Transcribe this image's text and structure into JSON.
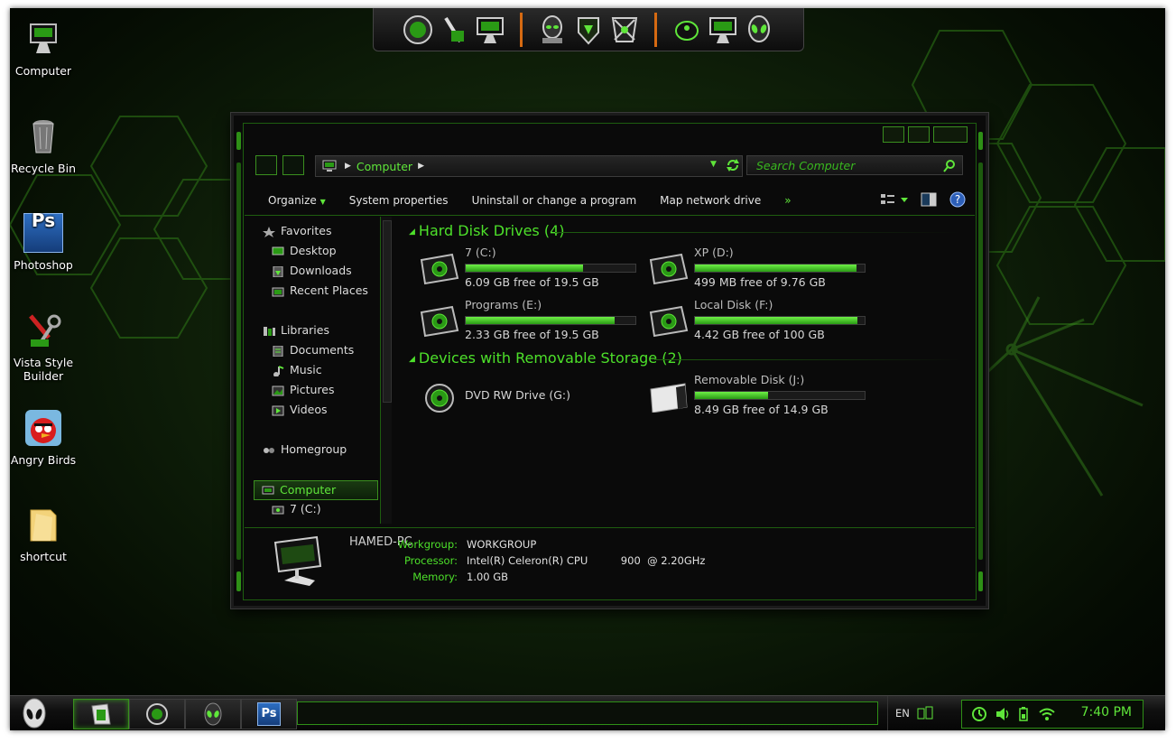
{
  "desktop": {
    "icons": [
      {
        "label": "Computer",
        "icon": "computer-icon"
      },
      {
        "label": "Recycle Bin",
        "icon": "recycle-bin-icon"
      },
      {
        "label": "Photoshop",
        "icon": "photoshop-icon",
        "badge": "Ps"
      },
      {
        "label": "Vista Style Builder",
        "icon": "vista-style-builder-icon"
      },
      {
        "label": "Angry Birds",
        "icon": "angry-birds-icon"
      },
      {
        "label": "shortcut",
        "icon": "folder-icon"
      }
    ]
  },
  "dock": {
    "groups": [
      [
        "alien-head-icon",
        "stylus-icon",
        "monitor-icon"
      ],
      [
        "alien-bust-icon",
        "shield-icon",
        "skull-icon"
      ],
      [
        "mouse-icon",
        "monitor-icon",
        "alien-logo-icon"
      ]
    ]
  },
  "explorer": {
    "address": {
      "segments": [
        "Computer"
      ]
    },
    "search": {
      "placeholder": "Search Computer"
    },
    "toolbar": {
      "organize": "Organize",
      "system_properties": "System properties",
      "uninstall": "Uninstall or change a program",
      "map_drive": "Map network drive",
      "more": "»"
    },
    "nav": {
      "favorites": "Favorites",
      "desktop": "Desktop",
      "downloads": "Downloads",
      "recent_places": "Recent Places",
      "libraries": "Libraries",
      "documents": "Documents",
      "music": "Music",
      "pictures": "Pictures",
      "videos": "Videos",
      "homegroup": "Homegroup",
      "computer": "Computer",
      "drive_c": "7 (C:)"
    },
    "groups": {
      "hard_disks": "Hard Disk Drives (4)",
      "removable": "Devices with Removable Storage (2)"
    },
    "drives": {
      "c": {
        "name": "7 (C:)",
        "free": "6.09 GB free of 19.5 GB",
        "used_fraction": 0.69
      },
      "d": {
        "name": "XP (D:)",
        "free": "499 MB free of 9.76 GB",
        "used_fraction": 0.95
      },
      "e": {
        "name": "Programs (E:)",
        "free": "2.33 GB free of 19.5 GB",
        "used_fraction": 0.88
      },
      "f": {
        "name": "Local Disk (F:)",
        "free": "4.42 GB free of 100 GB",
        "used_fraction": 0.96
      },
      "g": {
        "name": "DVD RW Drive (G:)"
      },
      "j": {
        "name": "Removable Disk (J:)",
        "free": "8.49 GB free of 14.9 GB",
        "used_fraction": 0.43
      }
    },
    "details": {
      "pc_name": "HAMED-PC",
      "workgroup_label": "Workgroup:",
      "workgroup": "WORKGROUP",
      "processor_label": "Processor:",
      "processor": "Intel(R) Celeron(R) CPU          900  @ 2.20GHz",
      "memory_label": "Memory:",
      "memory": "1.00 GB"
    }
  },
  "taskbar": {
    "buttons": [
      "explorer-icon",
      "media-player-icon",
      "alien-app-icon",
      "photoshop-icon"
    ],
    "photoshop_badge": "Ps",
    "language": "EN",
    "clock": "7:40 PM"
  },
  "theme": {
    "accent": "#4de02a",
    "accent_dark": "#1e5e0f",
    "highlight": "#d66a12"
  }
}
